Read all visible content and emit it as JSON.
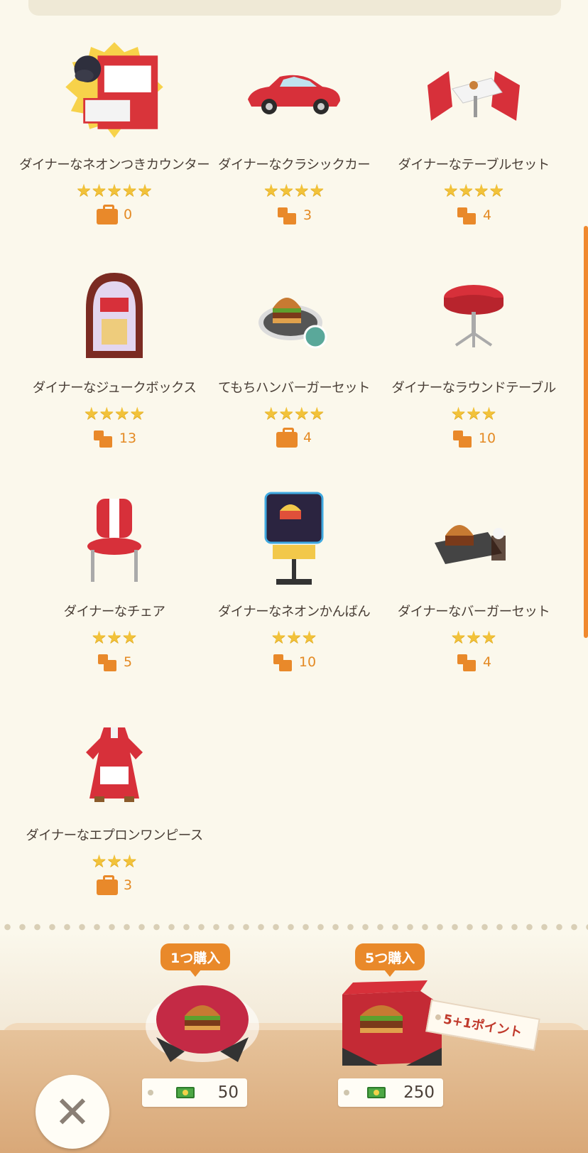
{
  "items": [
    {
      "name": "ダイナーなネオンつきカウンター",
      "stars": "★★★★★",
      "count": "0",
      "count_icon": "suitcase-icon"
    },
    {
      "name": "ダイナーなクラシックカー",
      "stars": "★★★★",
      "count": "3",
      "count_icon": "furniture-icon"
    },
    {
      "name": "ダイナーなテーブルセット",
      "stars": "★★★★",
      "count": "4",
      "count_icon": "furniture-icon"
    },
    {
      "name": "ダイナーなジュークボックス",
      "stars": "★★★★",
      "count": "13",
      "count_icon": "furniture-icon"
    },
    {
      "name": "てもちハンバーガーセット",
      "stars": "★★★★",
      "count": "4",
      "count_icon": "suitcase-icon"
    },
    {
      "name": "ダイナーなラウンドテーブル",
      "stars": "★★★",
      "count": "10",
      "count_icon": "furniture-icon"
    },
    {
      "name": "ダイナーなチェア",
      "stars": "★★★",
      "count": "5",
      "count_icon": "furniture-icon"
    },
    {
      "name": "ダイナーなネオンかんばん",
      "stars": "★★★",
      "count": "10",
      "count_icon": "furniture-icon"
    },
    {
      "name": "ダイナーなバーガーセット",
      "stars": "★★★",
      "count": "4",
      "count_icon": "furniture-icon"
    },
    {
      "name": "ダイナーなエプロンワンピース",
      "stars": "★★★",
      "count": "3",
      "count_icon": "suitcase-icon"
    }
  ],
  "purchase": {
    "single": {
      "label": "1つ購入",
      "price": "50"
    },
    "five": {
      "label": "5つ購入",
      "price": "250",
      "bonus": "5+1ポイント"
    }
  },
  "close_symbol": "✕",
  "colors": {
    "accent": "#e9892a",
    "star": "#f2c23a",
    "background": "#fbf8ec"
  }
}
